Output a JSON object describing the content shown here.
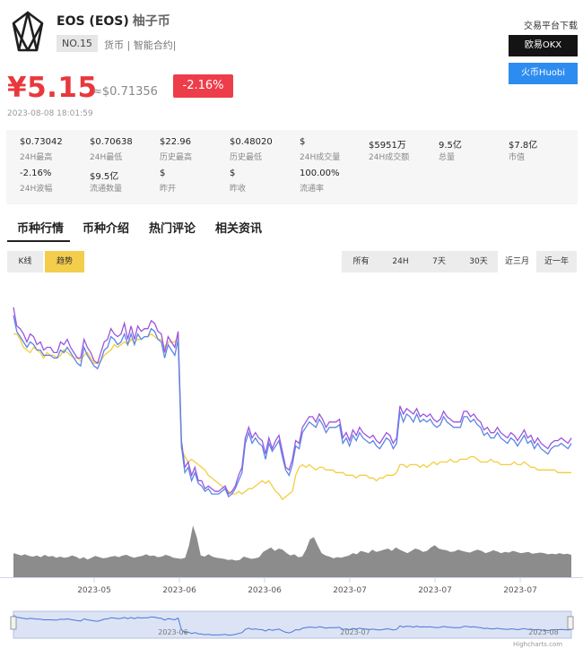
{
  "coin": {
    "name": "EOS (EOS)",
    "alias": "柚子币",
    "rank": "NO.15",
    "tags": "货币 | 智能合约|"
  },
  "price": {
    "cny": "¥5.15",
    "usd": "≈$0.71356",
    "change": "-2.16%",
    "timestamp": "2023-08-08 18:01:59"
  },
  "exchanges": {
    "title": "交易平台下载",
    "okx": "欧易OKX",
    "huobi": "火币Huobi"
  },
  "stats": [
    {
      "value": "$0.73042",
      "label": "24H最高"
    },
    {
      "value": "$0.70638",
      "label": "24H最低"
    },
    {
      "value": "$22.96",
      "label": "历史最高"
    },
    {
      "value": "$0.48020",
      "label": "历史最低"
    },
    {
      "value": "$",
      "label": "24H成交量"
    },
    {
      "value": "$5951万",
      "label": "24H成交额"
    },
    {
      "value": "9.5亿",
      "label": "总量"
    },
    {
      "value": "$7.8亿",
      "label": "市值"
    },
    {
      "value": "-2.16%",
      "label": "24H波幅"
    },
    {
      "value": "$9.5亿",
      "label": "流通数量"
    },
    {
      "value": "$",
      "label": "昨开"
    },
    {
      "value": "$",
      "label": "昨收"
    },
    {
      "value": "100.00%",
      "label": "流通率"
    }
  ],
  "tabs": [
    "币种行情",
    "币种介绍",
    "热门评论",
    "相关资讯"
  ],
  "chart_buttons": {
    "kline": "K线",
    "trend": "趋势"
  },
  "ranges": [
    "所有",
    "24H",
    "7天",
    "30天",
    "近三月",
    "近一年"
  ],
  "active_range": "近三月",
  "credit": "Highcharts.com",
  "colors": {
    "price_up": "#e8383d",
    "purple": "#9b55e0",
    "blue": "#5b86e5",
    "yellow": "#f5cd3e",
    "volume": "#8c8c8c",
    "navigator": "#dbe3f5"
  },
  "chart_data": {
    "type": "line",
    "x_ticks": [
      "2023-05",
      "2023-06",
      "2023-06",
      "2023-07",
      "2023-07",
      "2023-07"
    ],
    "navigator_ticks": [
      "2023-06",
      "2023-07",
      "2023-08"
    ],
    "series": [
      {
        "values": [
          1.05,
          0.98,
          0.97,
          0.95,
          0.92,
          0.95,
          0.94,
          0.91,
          0.92,
          0.89,
          0.9,
          0.9,
          0.88,
          0.88,
          0.92,
          0.91,
          0.93,
          0.9,
          0.88,
          0.86,
          0.86,
          0.93,
          0.9,
          0.88,
          0.85,
          0.84,
          0.88,
          0.92,
          0.93,
          0.97,
          0.95,
          0.94,
          0.95,
          0.99,
          0.93,
          0.98,
          0.93,
          0.98,
          0.96,
          0.97,
          0.97,
          1.0,
          0.99,
          0.96,
          0.95,
          0.88,
          0.94,
          0.92,
          0.9,
          0.96,
          0.55,
          0.45,
          0.47,
          0.42,
          0.45,
          0.4,
          0.4,
          0.37,
          0.38,
          0.37,
          0.36,
          0.36,
          0.37,
          0.38,
          0.35,
          0.36,
          0.38,
          0.42,
          0.45,
          0.56,
          0.6,
          0.56,
          0.58,
          0.56,
          0.55,
          0.5,
          0.56,
          0.52,
          0.55,
          0.57,
          0.51,
          0.45,
          0.44,
          0.48,
          0.55,
          0.54,
          0.6,
          0.62,
          0.64,
          0.64,
          0.62,
          0.65,
          0.63,
          0.6,
          0.62,
          0.62,
          0.62,
          0.63,
          0.56,
          0.58,
          0.55,
          0.59,
          0.57,
          0.6,
          0.58,
          0.57,
          0.56,
          0.57,
          0.55,
          0.54,
          0.56,
          0.58,
          0.57,
          0.54,
          0.56,
          0.68,
          0.65,
          0.67,
          0.66,
          0.65,
          0.67,
          0.64,
          0.65,
          0.64,
          0.65,
          0.63,
          0.62,
          0.63,
          0.66,
          0.64,
          0.63,
          0.62,
          0.62,
          0.62,
          0.66,
          0.66,
          0.64,
          0.65,
          0.63,
          0.62,
          0.59,
          0.6,
          0.58,
          0.58,
          0.6,
          0.58,
          0.57,
          0.56,
          0.58,
          0.57,
          0.55,
          0.57,
          0.59,
          0.56,
          0.57,
          0.54,
          0.56,
          0.54,
          0.53,
          0.52,
          0.54,
          0.55,
          0.55,
          0.56,
          0.55,
          0.54,
          0.56
        ]
      },
      {
        "values": [
          1.02,
          0.96,
          0.94,
          0.92,
          0.9,
          0.92,
          0.91,
          0.89,
          0.89,
          0.87,
          0.87,
          0.87,
          0.86,
          0.86,
          0.89,
          0.88,
          0.9,
          0.88,
          0.86,
          0.84,
          0.83,
          0.9,
          0.87,
          0.85,
          0.83,
          0.82,
          0.85,
          0.89,
          0.9,
          0.94,
          0.93,
          0.91,
          0.92,
          0.95,
          0.91,
          0.95,
          0.91,
          0.95,
          0.93,
          0.94,
          0.94,
          0.97,
          0.96,
          0.93,
          0.92,
          0.86,
          0.91,
          0.89,
          0.87,
          0.93,
          0.53,
          0.43,
          0.45,
          0.4,
          0.43,
          0.39,
          0.38,
          0.36,
          0.37,
          0.35,
          0.35,
          0.35,
          0.36,
          0.37,
          0.34,
          0.35,
          0.37,
          0.4,
          0.43,
          0.54,
          0.58,
          0.54,
          0.56,
          0.54,
          0.53,
          0.48,
          0.54,
          0.51,
          0.53,
          0.55,
          0.49,
          0.44,
          0.42,
          0.46,
          0.53,
          0.52,
          0.58,
          0.6,
          0.62,
          0.61,
          0.6,
          0.63,
          0.61,
          0.58,
          0.6,
          0.6,
          0.6,
          0.61,
          0.54,
          0.56,
          0.53,
          0.57,
          0.55,
          0.58,
          0.56,
          0.55,
          0.54,
          0.55,
          0.53,
          0.52,
          0.54,
          0.56,
          0.55,
          0.52,
          0.54,
          0.66,
          0.62,
          0.65,
          0.64,
          0.62,
          0.65,
          0.62,
          0.63,
          0.62,
          0.63,
          0.61,
          0.6,
          0.61,
          0.64,
          0.62,
          0.61,
          0.6,
          0.6,
          0.6,
          0.64,
          0.64,
          0.62,
          0.63,
          0.61,
          0.6,
          0.57,
          0.58,
          0.56,
          0.56,
          0.58,
          0.56,
          0.55,
          0.54,
          0.56,
          0.55,
          0.53,
          0.55,
          0.57,
          0.54,
          0.55,
          0.52,
          0.54,
          0.52,
          0.51,
          0.5,
          0.52,
          0.53,
          0.53,
          0.54,
          0.53,
          0.52,
          0.54
        ]
      },
      {
        "values": [
          0.95,
          0.95,
          0.93,
          0.9,
          0.89,
          0.88,
          0.9,
          0.89,
          0.88,
          0.86,
          0.88,
          0.87,
          0.87,
          0.86,
          0.87,
          0.89,
          0.88,
          0.87,
          0.86,
          0.86,
          0.85,
          0.87,
          0.88,
          0.86,
          0.84,
          0.84,
          0.85,
          0.87,
          0.88,
          0.89,
          0.91,
          0.9,
          0.91,
          0.92,
          0.91,
          0.93,
          0.92,
          0.93,
          0.93,
          0.94,
          0.94,
          0.95,
          0.94,
          0.93,
          0.93,
          0.9,
          0.92,
          0.92,
          0.92,
          0.94,
          0.52,
          0.49,
          0.47,
          0.48,
          0.47,
          0.46,
          0.45,
          0.44,
          0.42,
          0.41,
          0.4,
          0.39,
          0.38,
          0.37,
          0.36,
          0.35,
          0.35,
          0.36,
          0.35,
          0.36,
          0.37,
          0.37,
          0.38,
          0.39,
          0.4,
          0.39,
          0.4,
          0.38,
          0.36,
          0.35,
          0.33,
          0.34,
          0.35,
          0.36,
          0.42,
          0.45,
          0.46,
          0.45,
          0.46,
          0.45,
          0.44,
          0.45,
          0.45,
          0.44,
          0.44,
          0.44,
          0.43,
          0.43,
          0.43,
          0.42,
          0.42,
          0.42,
          0.41,
          0.42,
          0.42,
          0.42,
          0.41,
          0.41,
          0.4,
          0.41,
          0.41,
          0.42,
          0.42,
          0.42,
          0.43,
          0.46,
          0.46,
          0.45,
          0.46,
          0.46,
          0.46,
          0.45,
          0.46,
          0.45,
          0.46,
          0.47,
          0.46,
          0.47,
          0.47,
          0.47,
          0.48,
          0.47,
          0.47,
          0.48,
          0.48,
          0.48,
          0.49,
          0.49,
          0.48,
          0.47,
          0.47,
          0.47,
          0.48,
          0.47,
          0.47,
          0.46,
          0.46,
          0.46,
          0.46,
          0.47,
          0.46,
          0.46,
          0.47,
          0.46,
          0.45,
          0.45,
          0.44,
          0.44,
          0.44,
          0.44,
          0.44,
          0.44,
          0.43,
          0.43,
          0.43,
          0.43,
          0.43
        ]
      }
    ],
    "volume": [
      0.42,
      0.4,
      0.38,
      0.4,
      0.37,
      0.36,
      0.38,
      0.35,
      0.39,
      0.36,
      0.37,
      0.34,
      0.36,
      0.34,
      0.35,
      0.38,
      0.36,
      0.32,
      0.35,
      0.31,
      0.34,
      0.37,
      0.35,
      0.33,
      0.34,
      0.36,
      0.37,
      0.35,
      0.38,
      0.39,
      0.36,
      0.34,
      0.36,
      0.37,
      0.4,
      0.37,
      0.38,
      0.35,
      0.36,
      0.39,
      0.37,
      0.34,
      0.33,
      0.32,
      0.34,
      0.55,
      0.9,
      0.7,
      0.38,
      0.36,
      0.4,
      0.36,
      0.34,
      0.33,
      0.32,
      0.3,
      0.31,
      0.29,
      0.3,
      0.36,
      0.34,
      0.32,
      0.33,
      0.35,
      0.44,
      0.48,
      0.52,
      0.46,
      0.5,
      0.48,
      0.42,
      0.38,
      0.4,
      0.35,
      0.36,
      0.48,
      0.66,
      0.7,
      0.55,
      0.42,
      0.38,
      0.36,
      0.33,
      0.35,
      0.34,
      0.36,
      0.38,
      0.42,
      0.4,
      0.46,
      0.44,
      0.42,
      0.48,
      0.44,
      0.46,
      0.48,
      0.5,
      0.46,
      0.52,
      0.48,
      0.45,
      0.42,
      0.46,
      0.5,
      0.48,
      0.44,
      0.46,
      0.52,
      0.56,
      0.5,
      0.48,
      0.47,
      0.44,
      0.45,
      0.48,
      0.46,
      0.44,
      0.43,
      0.46,
      0.48,
      0.46,
      0.42,
      0.44,
      0.47,
      0.45,
      0.42,
      0.44,
      0.43,
      0.46,
      0.44,
      0.42,
      0.43,
      0.44,
      0.41,
      0.42,
      0.43,
      0.42,
      0.4,
      0.41,
      0.4,
      0.42,
      0.4,
      0.41,
      0.39
    ]
  }
}
